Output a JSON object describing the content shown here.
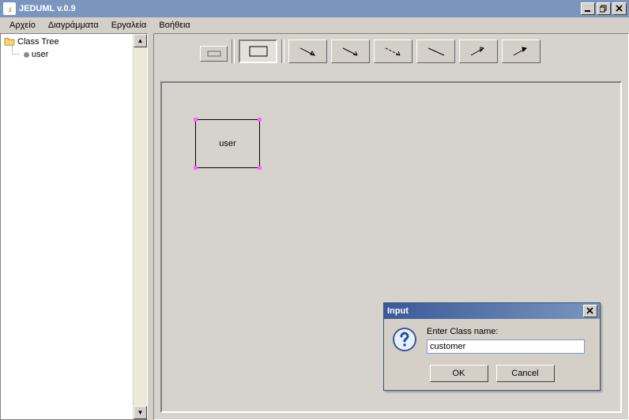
{
  "window": {
    "title": "JEDUML v.0.9"
  },
  "menu": {
    "items": [
      "Αρχείο",
      "Διαγράμματα",
      "Εργαλεία",
      "Βοήθεια"
    ]
  },
  "tree": {
    "root_label": "Class Tree",
    "items": [
      "user"
    ]
  },
  "toolbar": {
    "icons": {
      "mini": "mini-rect-icon",
      "rect": "rect-tool-icon",
      "assoc": "assoc-arrow-icon",
      "directed": "directed-arrow-icon",
      "dependency": "dependency-arrow-icon",
      "line": "line-tool-icon",
      "generalize": "generalize-arrow-icon",
      "realize": "realize-arrow-icon"
    }
  },
  "canvas": {
    "selected_box_label": "user"
  },
  "dialog": {
    "title": "Input",
    "prompt": "Enter Class name:",
    "value": "customer",
    "ok_label": "OK",
    "cancel_label": "Cancel"
  }
}
